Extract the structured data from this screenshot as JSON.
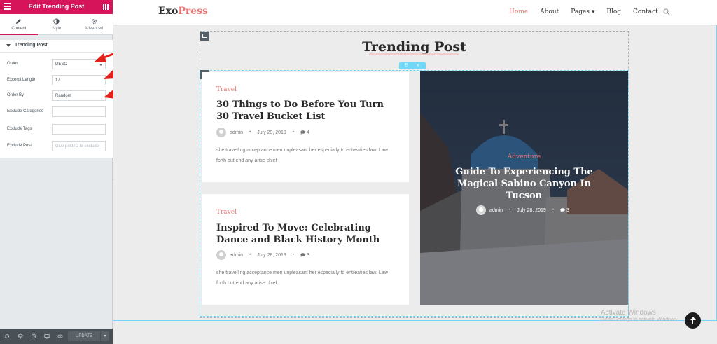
{
  "editor": {
    "header_title": "Edit Trending Post",
    "tabs": [
      {
        "label": "Content",
        "icon": "pencil-icon"
      },
      {
        "label": "Style",
        "icon": "contrast-icon"
      },
      {
        "label": "Advanced",
        "icon": "gear-icon"
      }
    ],
    "section_label": "Trending Post",
    "controls": {
      "order": {
        "label": "Order",
        "value": "DESC"
      },
      "excerpt_length": {
        "label": "Excerpt Length",
        "value": "17"
      },
      "order_by": {
        "label": "Order By",
        "value": "Random"
      },
      "exclude_categories": {
        "label": "Exclude Categories",
        "value": ""
      },
      "exclude_tags": {
        "label": "Exclude Tags",
        "value": ""
      },
      "exclude_post": {
        "label": "Exclude Post",
        "placeholder": "Give post ID to exclude"
      }
    },
    "footer": {
      "update_label": "UPDATE",
      "update_arrow": "▾"
    }
  },
  "site": {
    "logo": {
      "part1": "Exo",
      "part2": "Press"
    },
    "nav": [
      {
        "label": "Home",
        "active": true
      },
      {
        "label": "About"
      },
      {
        "label": "Pages ▾"
      },
      {
        "label": "Blog"
      },
      {
        "label": "Contact"
      }
    ],
    "section_title": "Trending Post",
    "edit_tab": {
      "move": "⠿",
      "close": "✕"
    },
    "posts": [
      {
        "category": "Travel",
        "title": "30 Things to Do Before You Turn 30 Travel Bucket List",
        "author": "admin",
        "date": "July 29, 2019",
        "comments": "4",
        "excerpt": "she travelling acceptance men unpleasant her especially to entreaties law. Law forth but end any arise chief"
      },
      {
        "category": "Travel",
        "title": "Inspired To Move: Celebrating Dance and Black History Month",
        "author": "admin",
        "date": "July 28, 2019",
        "comments": "3",
        "excerpt": "she travelling acceptance men unpleasant her especially to entreaties law. Law forth but end any arise chief"
      }
    ],
    "featured": {
      "category": "Adventure",
      "title": "Guide To Experiencing The Magical Sabino Canyon In Tucson",
      "author": "admin",
      "date": "July 28, 2019",
      "comments": "3"
    }
  },
  "os_watermark": {
    "line1": "Activate Windows",
    "line2": "Go to Settings to activate Windows."
  },
  "colors": {
    "editor_accent": "#d5145a",
    "site_accent": "#e77877",
    "frame_accent": "#71d7f7",
    "annotation_arrow": "#e3211c"
  }
}
